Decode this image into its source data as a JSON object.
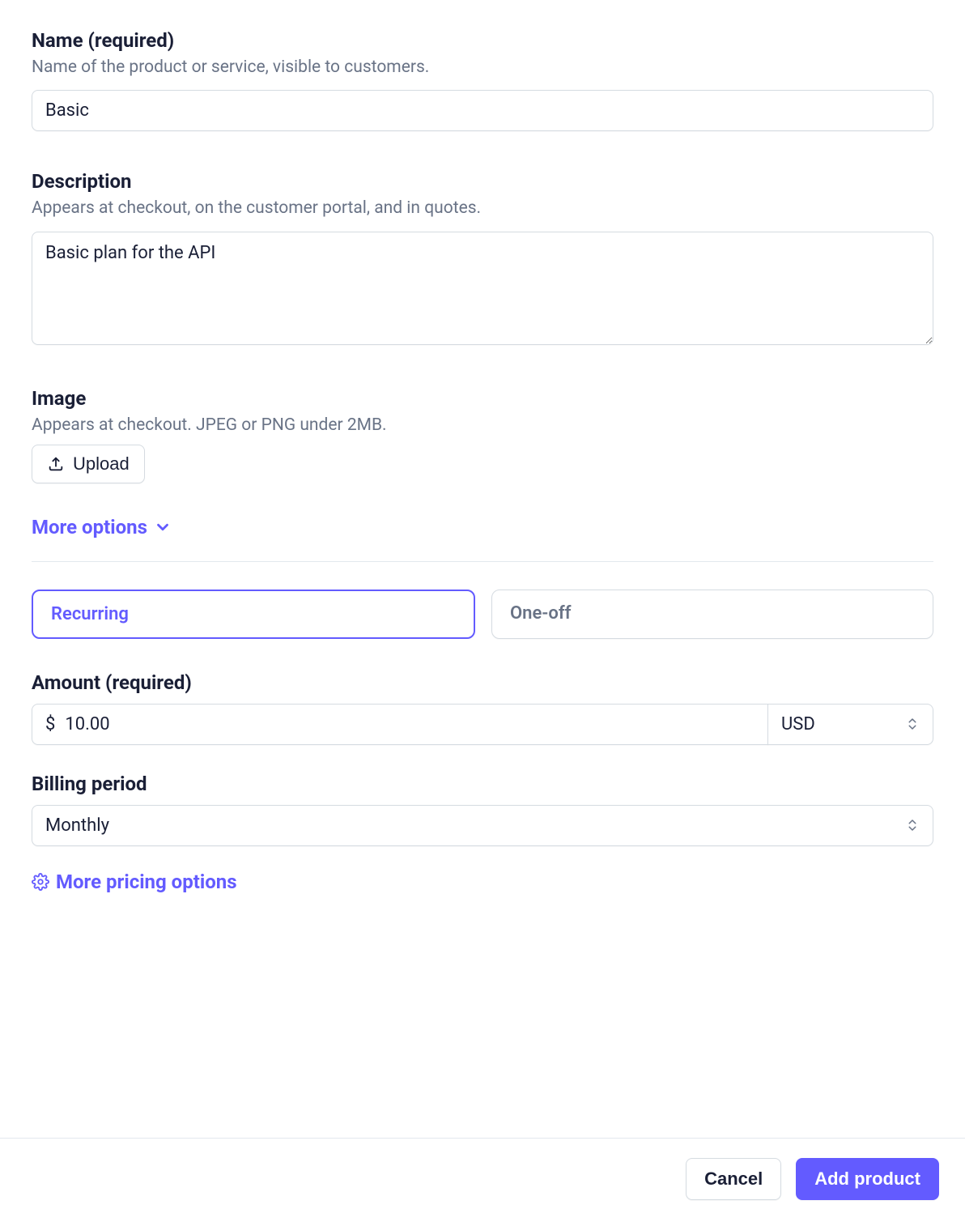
{
  "name": {
    "label": "Name (required)",
    "help": "Name of the product or service, visible to customers.",
    "value": "Basic"
  },
  "description": {
    "label": "Description",
    "help": "Appears at checkout, on the customer portal, and in quotes.",
    "value": "Basic plan for the API"
  },
  "image": {
    "label": "Image",
    "help": "Appears at checkout. JPEG or PNG under 2MB.",
    "upload_label": "Upload"
  },
  "more_options_label": "More options",
  "pricing": {
    "tabs": {
      "recurring": "Recurring",
      "one_off": "One-off"
    },
    "amount": {
      "label": "Amount (required)",
      "prefix": "$",
      "value": "10.00",
      "currency": "USD"
    },
    "billing_period": {
      "label": "Billing period",
      "value": "Monthly"
    },
    "more_pricing_options_label": "More pricing options"
  },
  "footer": {
    "cancel": "Cancel",
    "add_product": "Add product"
  }
}
